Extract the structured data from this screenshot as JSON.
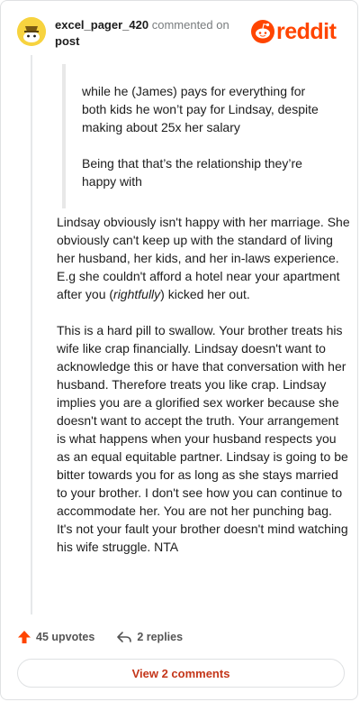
{
  "comment": {
    "username": "excel_pager_420",
    "action_text": "commented on",
    "target": "post",
    "brand": "reddit",
    "quote_paragraphs": [
      "while he (James) pays for everything for both kids he won’t pay for Lindsay, despite making about 25x her salary",
      "Being that that’s the relationship they’re happy with"
    ],
    "body_p1_before": "Lindsay obviously isn't happy with her marriage. She obviously can't keep up with the standard of living her husband, her kids, and her in-laws experience. E.g she couldn't afford a hotel near your apartment after you (",
    "body_p1_em": "rightfully",
    "body_p1_after": ") kicked her out.",
    "body_p2": "This is a hard pill to swallow. Your brother treats his wife like crap financially. Lindsay doesn't want to acknowledge this or have that conversation with her husband. Therefore treats you like crap. Lindsay implies you are a glorified sex worker because she doesn't want to accept the truth. Your arrangement is what happens when your husband respects you as an equal equitable partner. Lindsay is going to be bitter towards you for as long as she stays married to your brother. I don't see how you can continue to accommodate her. You are not her punching bag. It's not your fault your brother doesn't mind watching his wife struggle. NTA"
  },
  "actions": {
    "upvotes": "45 upvotes",
    "replies": "2 replies",
    "view_comments": "View 2 comments"
  },
  "colors": {
    "brand": "#ff4500",
    "upvote": "#ff4500",
    "view_button_text": "#c4361a",
    "avatar": "#f7d33f"
  },
  "icons": {
    "avatar": "snoo-avatar",
    "brand": "reddit-logo",
    "upvote": "upvote-arrow-icon",
    "reply": "reply-arrow-icon"
  }
}
